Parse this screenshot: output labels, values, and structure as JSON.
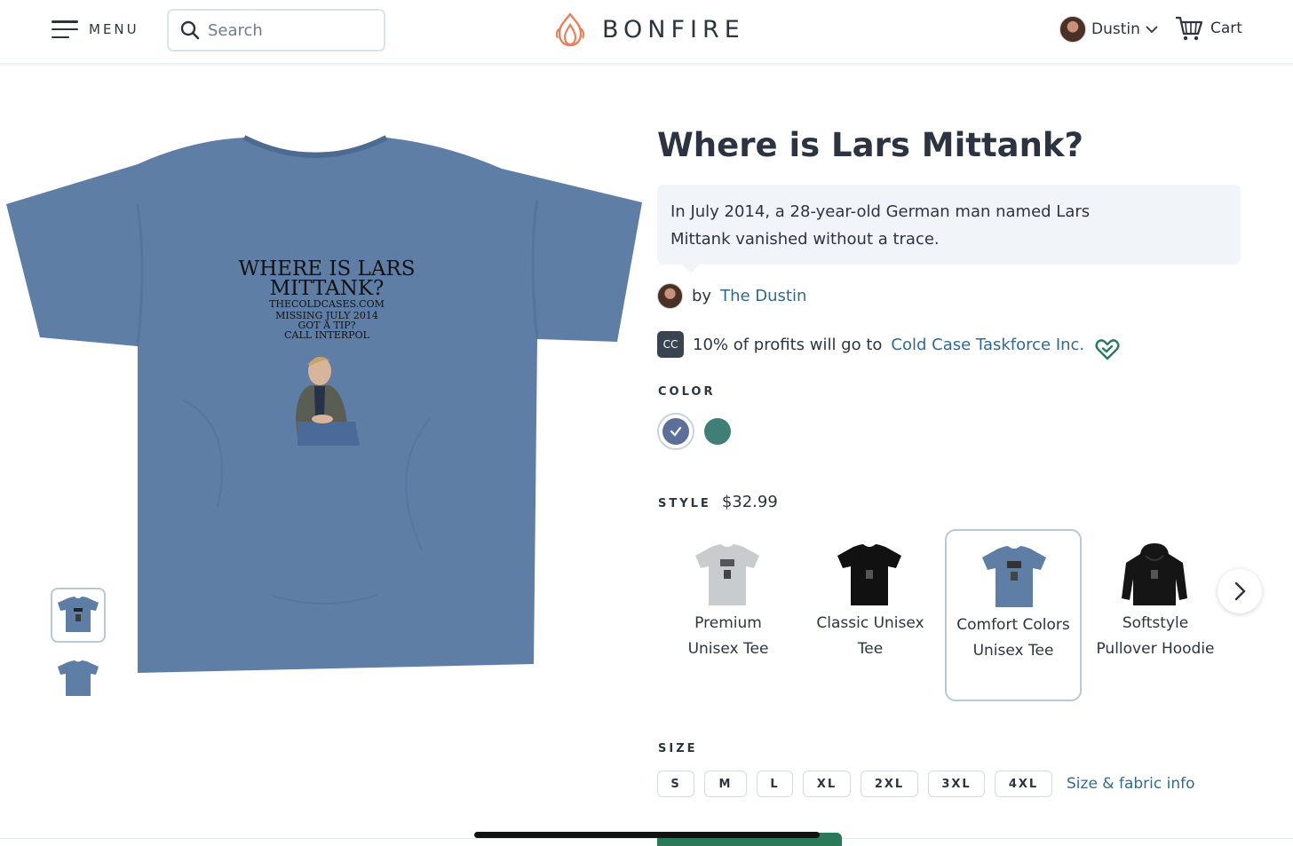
{
  "header": {
    "menu_label": "MENU",
    "search_placeholder": "Search",
    "logo_text": "BONFIRE",
    "user_name": "Dustin",
    "cart_label": "Cart"
  },
  "product": {
    "title": "Where is Lars Mittank?",
    "description": "In July 2014, a 28-year-old German man named Lars Mittank vanished without a trace.",
    "by_prefix": "by",
    "creator": "The Dustin",
    "charity_badge": "CC",
    "charity_prefix": "10% of profits will go to",
    "charity_name": "Cold Case Taskforce Inc.",
    "print_lines": [
      "WHERE IS LARS",
      "MITTANK?",
      "THECOLDCASES.COM",
      "MISSING JULY 2014",
      "GOT A TIP?",
      "CALL INTERPOL"
    ]
  },
  "color": {
    "label": "COLOR",
    "options": [
      {
        "name": "blue",
        "hex": "#5c6f9a",
        "selected": true
      },
      {
        "name": "teal",
        "hex": "#3f7f78",
        "selected": false
      }
    ]
  },
  "style": {
    "label": "STYLE",
    "price": "$32.99",
    "options": [
      {
        "name": "Premium Unisex Tee",
        "color": "#c9cccf",
        "selected": false
      },
      {
        "name": "Classic Unisex Tee",
        "color": "#111111",
        "selected": false
      },
      {
        "name": "Comfort Colors Unisex Tee",
        "color": "#5f7ea6",
        "selected": true
      },
      {
        "name": "Softstyle Pullover Hoodie",
        "color": "#151515",
        "selected": false
      }
    ]
  },
  "size": {
    "label": "SIZE",
    "options": [
      "S",
      "M",
      "L",
      "XL",
      "2XL",
      "3XL",
      "4XL"
    ],
    "info_link": "Size & fabric info"
  },
  "colors": {
    "text": "#2b3440",
    "link": "#2f6a93",
    "shirt_blue": "#5f7ea6",
    "cta_green": "#2a7a5a",
    "logo_orange": "#e8805a"
  }
}
